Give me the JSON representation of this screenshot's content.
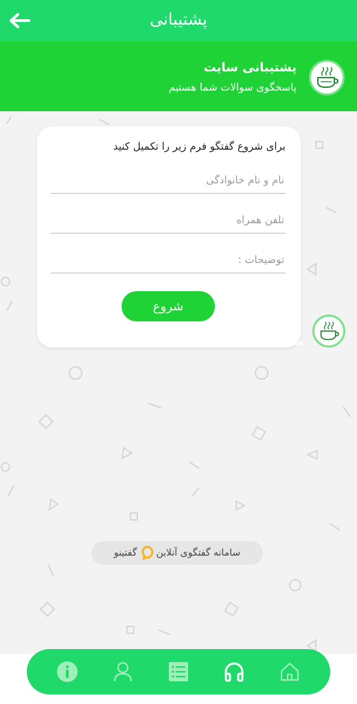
{
  "appbar": {
    "title": "پشتیبانی"
  },
  "support": {
    "title": "پشتیبانی سایت",
    "subtitle": "پاسخگوی سوالات شما هستیم"
  },
  "form": {
    "intro": "برای شروع گفتگو فرم زیر را تکمیل کنید",
    "name_placeholder": "نام و نام خانوادگی",
    "phone_placeholder": "تلفن همراه",
    "notes_placeholder": "توضیحات :",
    "start_label": "شروع"
  },
  "powered": {
    "text": "سامانه گفتگوی آنلاین",
    "brand": "گفتینو"
  },
  "nav": {
    "items": [
      "home-icon",
      "headphones-icon",
      "list-icon",
      "user-icon",
      "info-icon"
    ]
  },
  "colors": {
    "appbar": "#1fd96b",
    "header": "#1fd235",
    "brand_accent": "#f3b41f"
  }
}
